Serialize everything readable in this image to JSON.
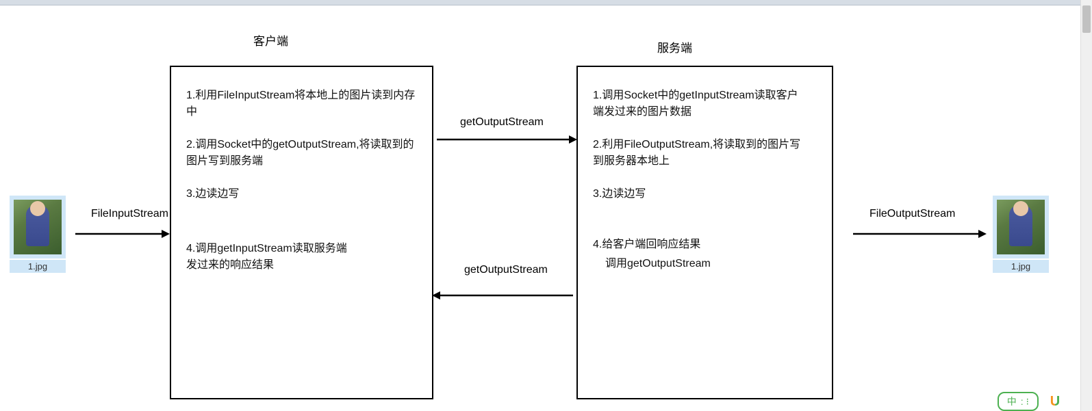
{
  "client": {
    "title": "客户端",
    "lines": {
      "l1": "1.利用FileInputStream将本地上的图片读到内存中",
      "l2": "2.调用Socket中的getOutputStream,将读取到的图片写到服务端",
      "l3": "3.边读边写",
      "l4": "4.调用getInputStream读取服务端发过来的响应结果"
    }
  },
  "server": {
    "title": "服务端",
    "lines": {
      "l1": "1.调用Socket中的getInputStream读取客户端发过来的图片数据",
      "l2": "2.利用FileOutputStream,将读取到的图片写到服务器本地上",
      "l3": "3.边读边写",
      "l4a": "4.给客户端回响应结果",
      "l4b": "调用getOutputStream"
    }
  },
  "arrows": {
    "fileInputStream": "FileInputStream",
    "getOutputStreamTop": "getOutputStream",
    "getOutputStreamBottom": "getOutputStream",
    "fileOutputStream": "FileOutputStream"
  },
  "images": {
    "left": "1.jpg",
    "right": "1.jpg"
  },
  "ime": {
    "text": "中",
    "dots": ": ⁝"
  }
}
